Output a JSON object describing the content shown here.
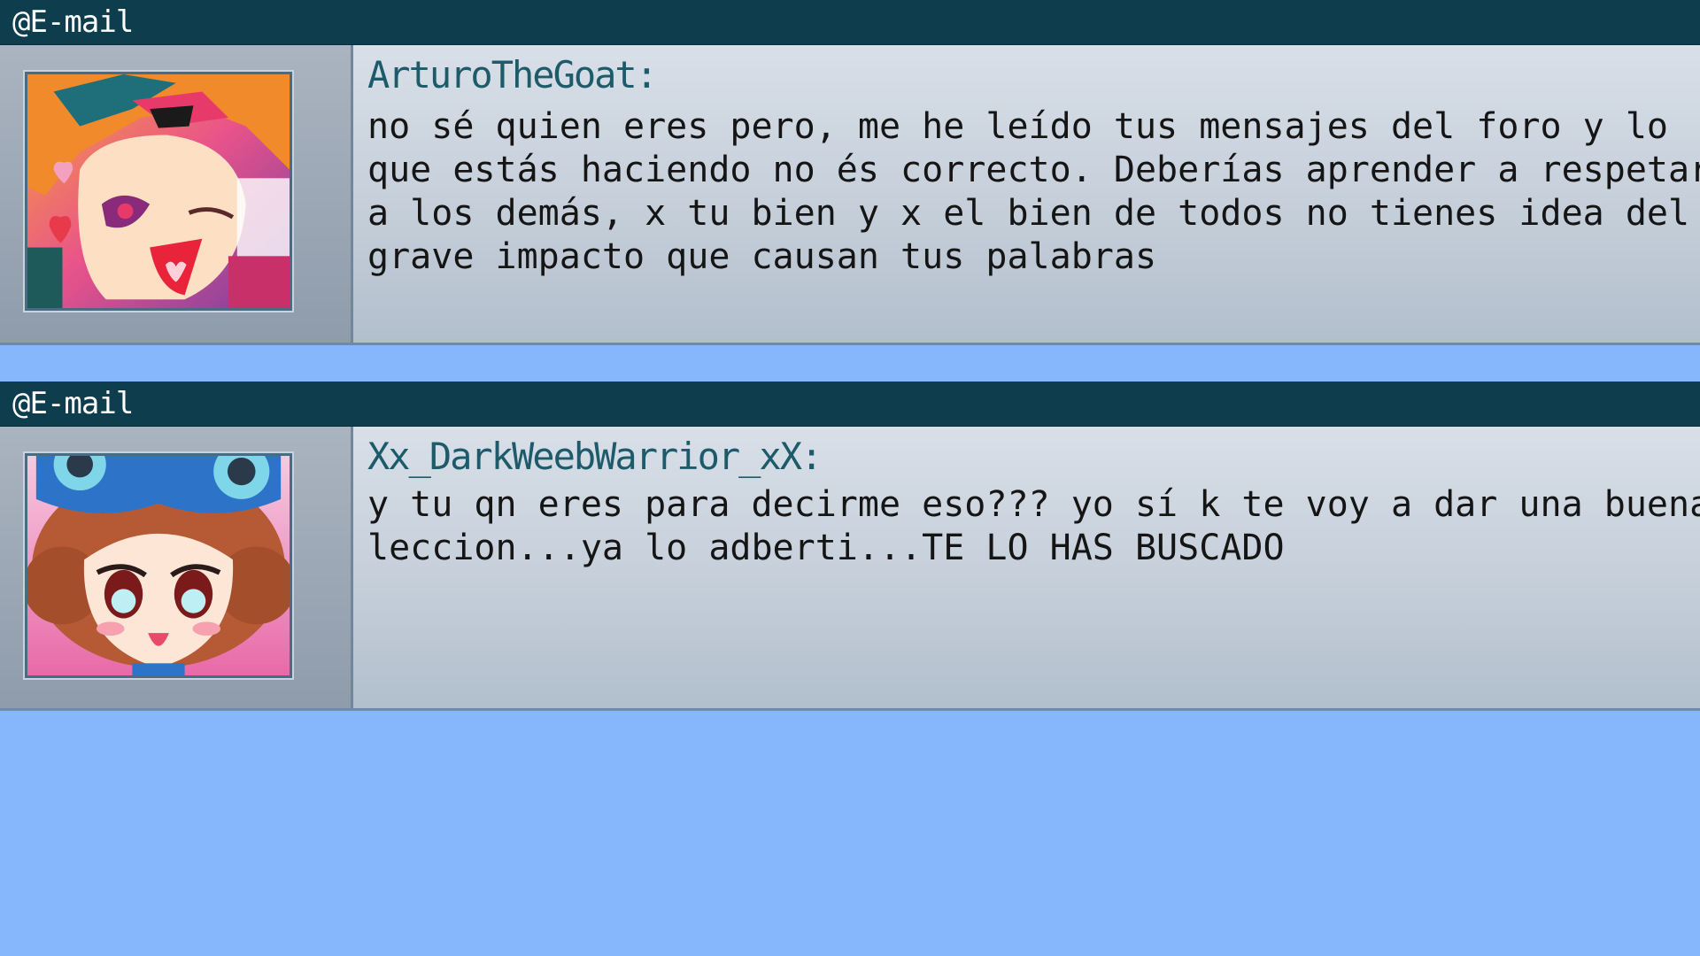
{
  "messages": [
    {
      "header": "@E-mail",
      "sender": "ArturoTheGoat:",
      "text_lines": [
        "no sé quien eres pero, me he leído tus mensajes del foro y lo",
        "que estás haciendo no és correcto. Deberías aprender a respetar",
        "a los demás, x tu bien y x el bien de todos no tienes idea del",
        "grave impacto que causan tus palabras"
      ],
      "avatar_icon": "anime-girl-winking-avatar"
    },
    {
      "header": "@E-mail",
      "sender": "Xx_DarkWeebWarrior_xX:",
      "text_lines": [
        "y tu qn eres para decirme eso??? yo sí k te voy a dar una buena",
        "leccion...ya lo adberti...TE LO HAS BUSCADO"
      ],
      "avatar_icon": "anime-girl-blue-bow-avatar"
    }
  ],
  "colors": {
    "title_bar": "#0e3d4e",
    "background": "#86b6fb",
    "sender_name": "#1d5a6a"
  }
}
